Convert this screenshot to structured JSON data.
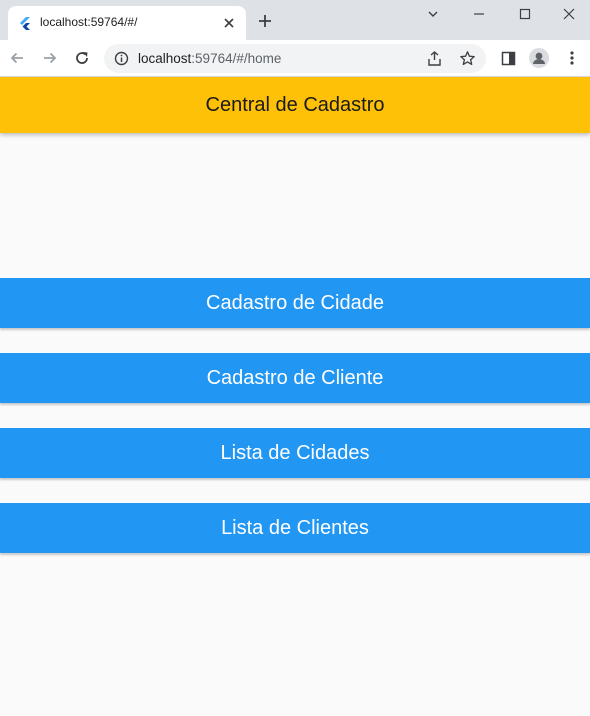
{
  "browser": {
    "tab_title": "localhost:59764/#/",
    "url_host": "localhost",
    "url_path": ":59764/#/home"
  },
  "app": {
    "title": "Central de Cadastro",
    "buttons": [
      {
        "label": "Cadastro de Cidade"
      },
      {
        "label": "Cadastro de Cliente"
      },
      {
        "label": "Lista de Cidades"
      },
      {
        "label": "Lista de Clientes"
      }
    ]
  },
  "colors": {
    "appbar": "#ffc107",
    "button": "#2196f3",
    "background": "#fafafa"
  }
}
